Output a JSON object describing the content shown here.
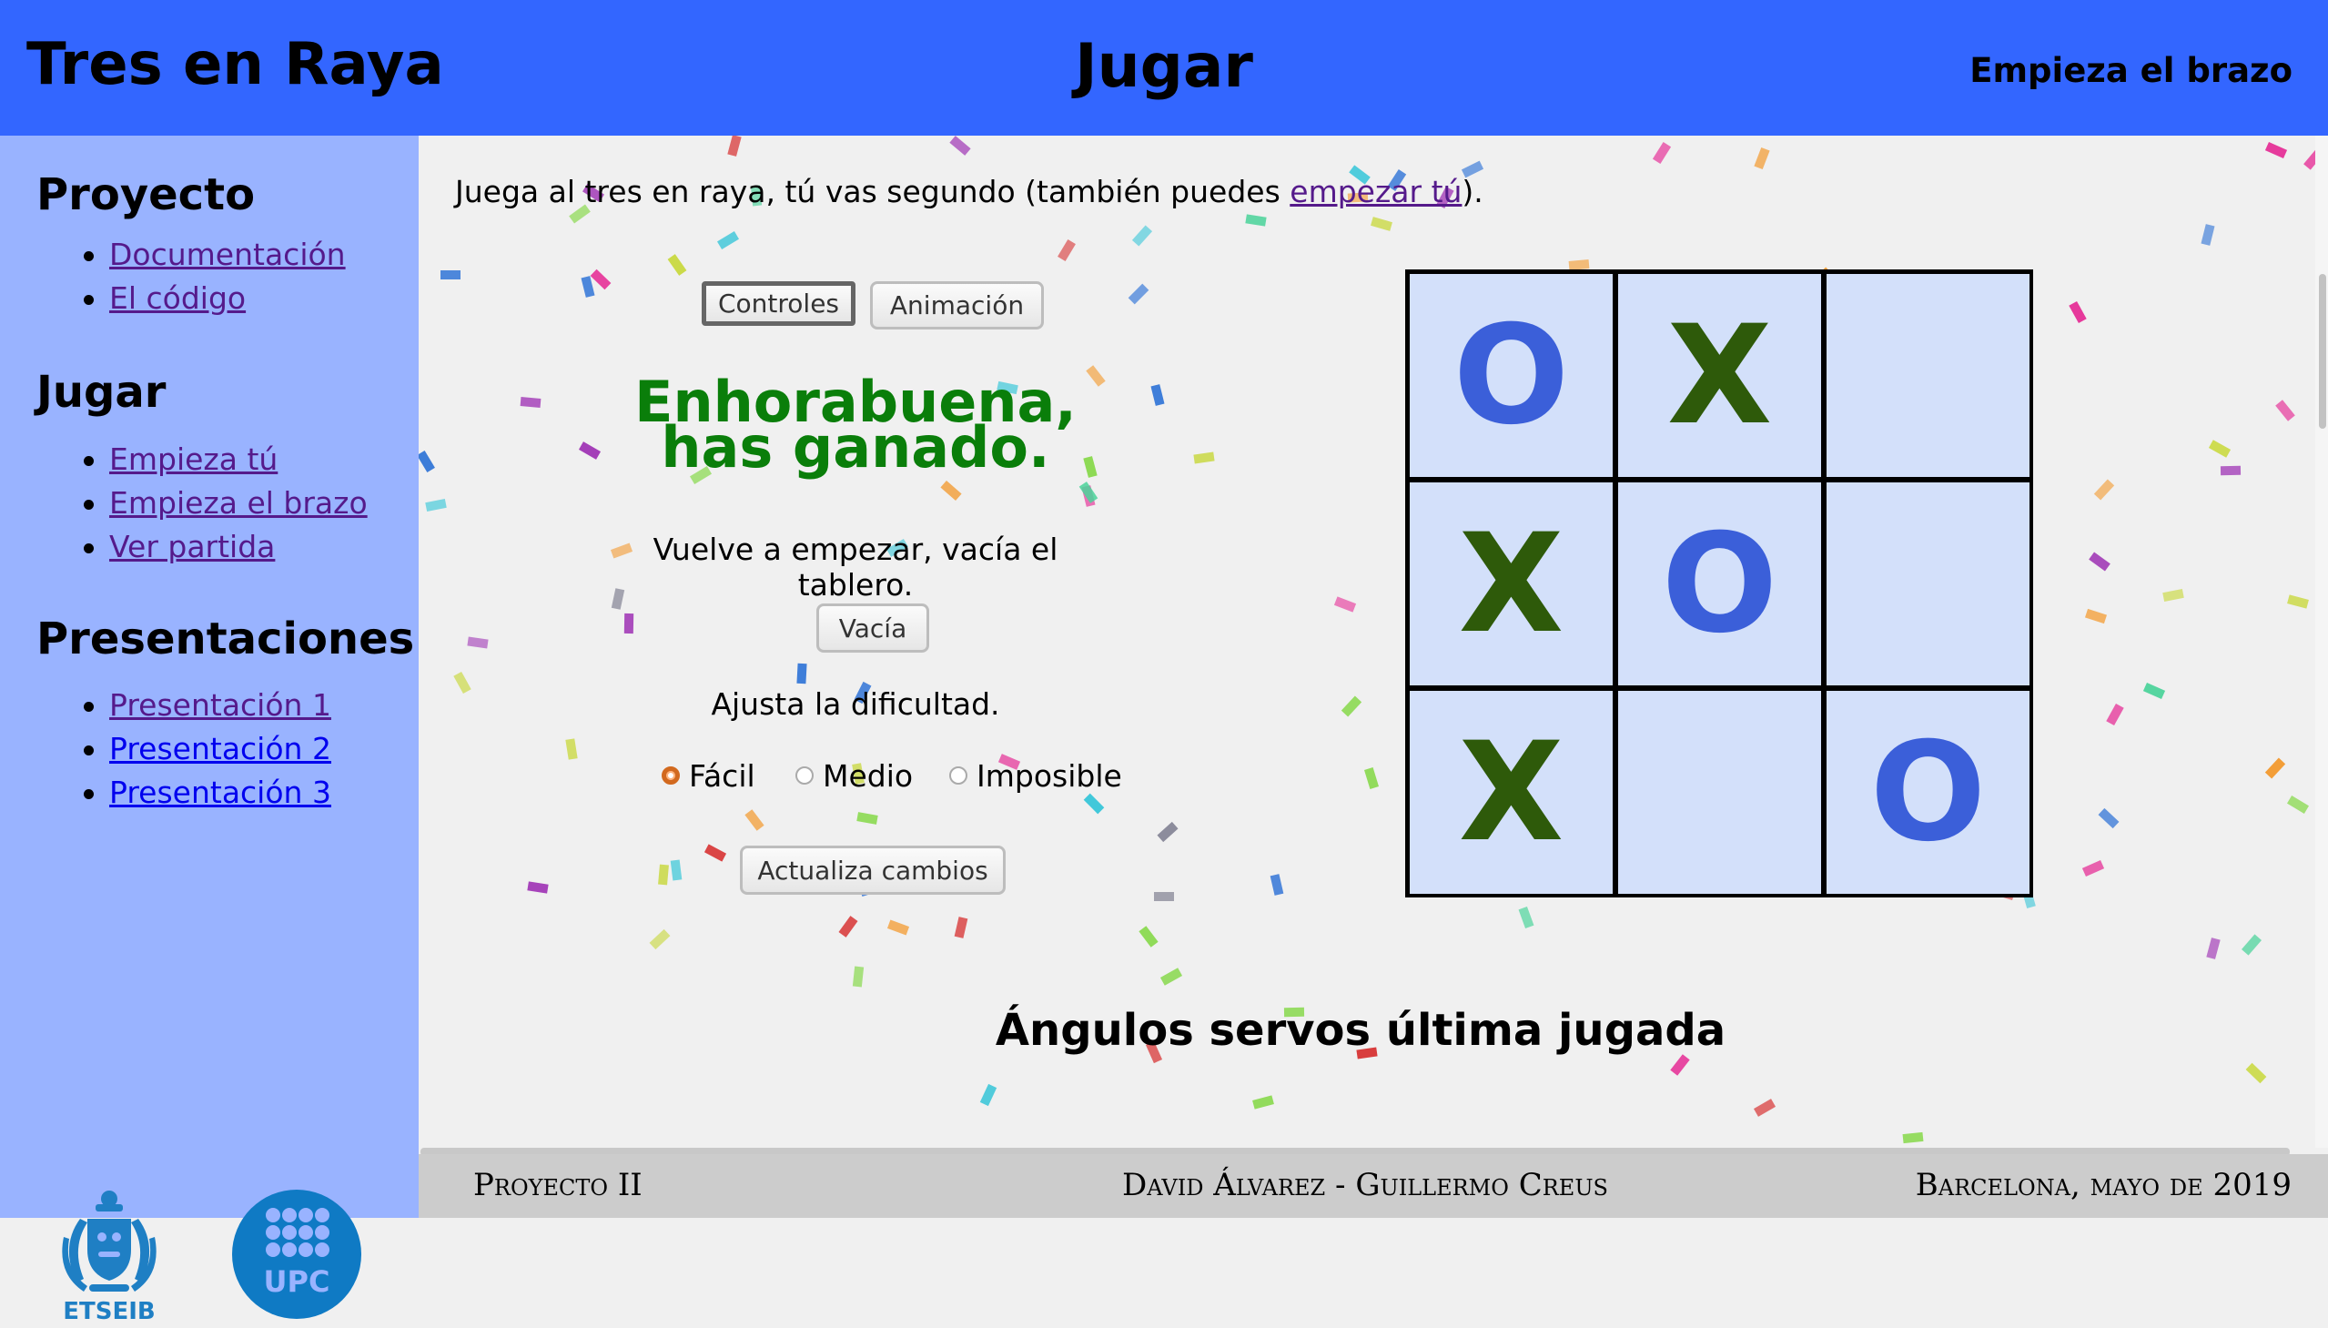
{
  "header": {
    "site_title": "Tres en Raya",
    "page_heading": "Jugar",
    "mode_label": "Empieza el brazo"
  },
  "sidebar": {
    "sections": [
      {
        "title": "Proyecto",
        "items": [
          {
            "label": "Documentación"
          },
          {
            "label": "El código"
          }
        ]
      },
      {
        "title": "Jugar",
        "items": [
          {
            "label": "Empieza tú"
          },
          {
            "label": "Empieza el brazo"
          },
          {
            "label": "Ver partida"
          }
        ]
      },
      {
        "title": "Presentaciones",
        "items": [
          {
            "label": "Presentación 1"
          },
          {
            "label": "Presentación 2"
          },
          {
            "label": "Presentación 3"
          }
        ]
      }
    ],
    "logos": {
      "etseib": "ETSEIB",
      "upc": "UPC"
    }
  },
  "main": {
    "intro_before": "Juega al tres en raya, tú vas segundo (también puedes ",
    "intro_link": "empezar tú",
    "intro_after": ").",
    "tabs": [
      {
        "label": "Controles",
        "active": true
      },
      {
        "label": "Animación",
        "active": false
      }
    ],
    "win_message_line1": "Enhorabuena,",
    "win_message_line2": "has ganado.",
    "restart_text": "Vuelve a empezar, vacía el tablero.",
    "clear_button": "Vacía",
    "difficulty_text": "Ajusta la dificultad.",
    "difficulty_options": [
      {
        "label": "Fácil",
        "selected": true
      },
      {
        "label": "Medio",
        "selected": false
      },
      {
        "label": "Imposible",
        "selected": false
      }
    ],
    "update_button": "Actualiza cambios",
    "board": [
      [
        "O",
        "X",
        ""
      ],
      [
        "X",
        "O",
        ""
      ],
      [
        "X",
        "",
        "O"
      ]
    ],
    "servo_title": "Ángulos servos última jugada"
  },
  "footer": {
    "left": "Proyecto II",
    "center": "David Álvarez - Guillermo Creus",
    "right": "Barcelona, mayo de 2019"
  },
  "colors": {
    "header": "#3366ff",
    "sidebar": "#99b3ff",
    "win_message": "#0a7e0a",
    "piece_o": "#3b5fd9",
    "piece_x": "#2e5a0a",
    "board_cell": "#d3e0fa"
  }
}
